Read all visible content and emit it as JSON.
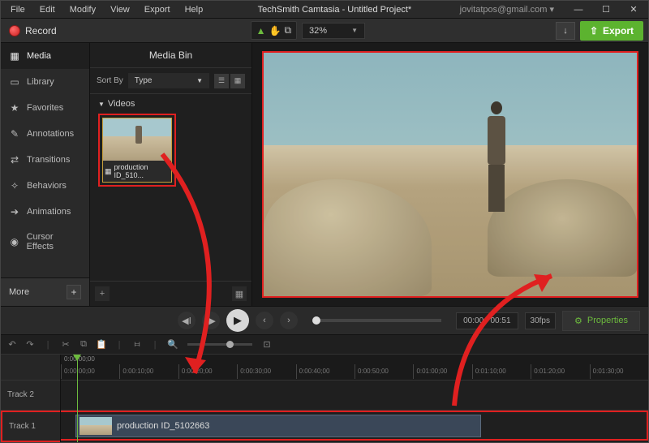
{
  "menubar": {
    "items": [
      "File",
      "Edit",
      "Modify",
      "View",
      "Export",
      "Help"
    ]
  },
  "title": "TechSmith Camtasia - Untitled Project*",
  "account": "jovitatpos@gmail.com ▾",
  "toolbar": {
    "record": "Record",
    "zoom": "32%",
    "export": "Export"
  },
  "sidebar": {
    "items": [
      {
        "icon": "▦",
        "label": "Media"
      },
      {
        "icon": "▭",
        "label": "Library"
      },
      {
        "icon": "★",
        "label": "Favorites"
      },
      {
        "icon": "✎",
        "label": "Annotations"
      },
      {
        "icon": "⇄",
        "label": "Transitions"
      },
      {
        "icon": "✧",
        "label": "Behaviors"
      },
      {
        "icon": "➔",
        "label": "Animations"
      },
      {
        "icon": "◉",
        "label": "Cursor Effects"
      }
    ],
    "more": "More"
  },
  "media_bin": {
    "title": "Media Bin",
    "sort_by": "Sort By",
    "sort_type": "Type",
    "videos_label": "Videos",
    "clip_name": "production ID_510..."
  },
  "playback": {
    "time": "00:00 / 00:51",
    "fps": "30fps",
    "properties": "Properties"
  },
  "timeline": {
    "start_tc": "0:00:00;00",
    "ticks": [
      "0:00:00;00",
      "0:00:10;00",
      "0:00:20;00",
      "0:00:30;00",
      "0:00:40;00",
      "0:00:50;00",
      "0:01:00;00",
      "0:01:10;00",
      "0:01:20;00",
      "0:01:30;00"
    ],
    "track2": "Track 2",
    "track1": "Track 1",
    "clip_name": "production ID_5102663"
  }
}
